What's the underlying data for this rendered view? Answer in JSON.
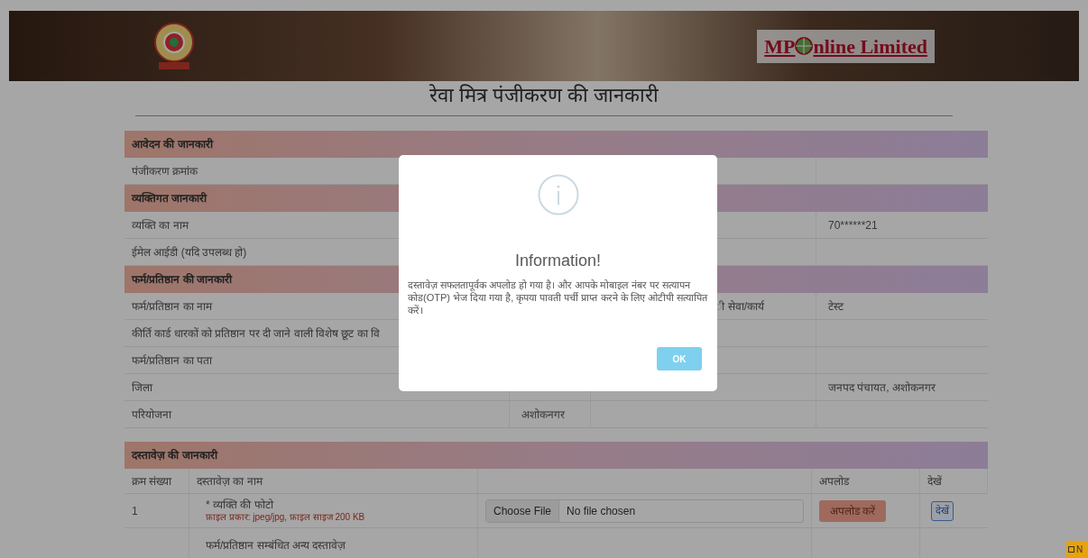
{
  "header": {
    "brand_prefix": "MP",
    "brand_suffix": "nline Limited"
  },
  "page_title": "रेवा मित्र पंजीकरण की जानकारी",
  "sections": [
    {
      "title": "आवेदन की जानकारी",
      "rows": [
        {
          "label": "पंजीकरण क्रमांक"
        }
      ]
    },
    {
      "title": "व्यक्तिगत जानकारी",
      "rows": [
        {
          "label": "व्यक्ति का नाम",
          "value_2": "70******21"
        },
        {
          "label": "ईमेल आईडी (यदि उपलब्ध हो)"
        }
      ]
    },
    {
      "title": "फर्म/प्रतिष्ठान की जानकारी",
      "rows": [
        {
          "label": "फर्म/प्रतिष्ठान का नाम",
          "label_2": "ी सेवा/कार्य",
          "value_2": "टेस्ट"
        },
        {
          "label": "कीर्ति कार्ड धारकों को प्रतिष्ठान पर दी जाने वाली विशेष छूट का वि"
        },
        {
          "label": "फर्म/प्रतिष्ठान का पता"
        },
        {
          "label": "जिला",
          "value_2": "जनपद पंचायत, अशोकनगर"
        },
        {
          "label": "परियोजना",
          "value": "अशोकनगर"
        }
      ]
    }
  ],
  "documents": {
    "title": "दस्तावेज़ की जानकारी",
    "columns": [
      "क्रम संख्या",
      "दस्तावेज़ का नाम",
      "अपलोड",
      "देखें"
    ],
    "rows": [
      {
        "serial": "1",
        "name": "* व्यक्ति की फोटो",
        "hint": "फ़ाइल प्रकार: jpeg/jpg, फ़ाइल साइज 200 KB",
        "file_button": "Choose File",
        "file_status": "No file chosen",
        "upload_button": "अपलोड करें",
        "view_button": "देखें"
      },
      {
        "name": "फर्म/प्रतिष्ठान सम्बंधित अन्य दस्तावेज़"
      }
    ]
  },
  "modal": {
    "title": "Information!",
    "message": "दस्तावेज़ सफलतापूर्वक अपलोड हो गया है। और आपके मोबाइल नंबर पर सत्यापन कोड(OTP) भेज दिया गया है, कृपया पावती पर्ची प्राप्त करने के लिए ओटीपी सत्यापित करें।",
    "ok_button": "OK"
  },
  "corner_badge": "N"
}
